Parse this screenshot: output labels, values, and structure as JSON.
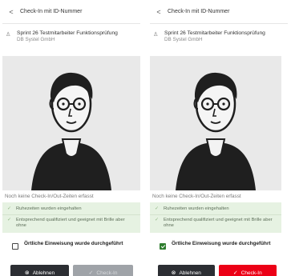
{
  "header": {
    "title": "Check-In mit ID-Nummer",
    "back_icon": "chevron-left-icon"
  },
  "person": {
    "name": "Sprint 26 Testmitarbeiter Funktionsprüfung",
    "company": "DB Systel GmbH",
    "icon": "person-icon"
  },
  "photo": {
    "alt": "avatar-illustration"
  },
  "status_note": "Noch keine Check-In/Out-Zeiten erfasst",
  "checks": [
    "Ruhezeiten wurden eingehalten",
    "Entsprechend qualifiziert und geeignet mit Brille aber ohne"
  ],
  "confirmation": {
    "label": "Örtliche Einweisung wurde durchgeführt",
    "left_checked": false,
    "right_checked": true
  },
  "buttons": {
    "reject_label": "Ablehnen",
    "reject_icon": "⊗",
    "checkin_label": "Check-In",
    "checkin_icon": "✓"
  },
  "colors": {
    "brand_red": "#ec0016",
    "check_green": "#2f7d2f",
    "success_bg": "#e6f2e2",
    "dark_button": "#2c2e33",
    "disabled_button": "#9fa3a8"
  }
}
